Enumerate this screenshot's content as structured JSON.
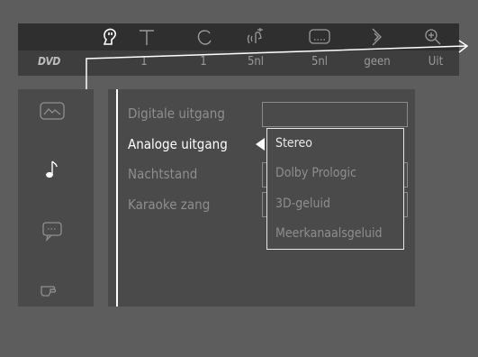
{
  "menu_bar": {
    "logo": "DVD",
    "icons": [
      "audio-settings-icon",
      "subtitle-icon",
      "chapter-icon",
      "audio-language-icon",
      "menu-icon",
      "angle-icon",
      "zoom-icon"
    ],
    "values": [
      "1",
      "1",
      "5nl",
      "5nl",
      "geen",
      "Uit"
    ]
  },
  "sidebar": {
    "icons": [
      "picture-icon",
      "music-note-icon",
      "speech-bubble-icon",
      "pointer-hand-icon"
    ]
  },
  "settings": {
    "labels": [
      "Digitale uitgang",
      "Analoge uitgang",
      "Nachtstand",
      "Karaoke zang"
    ],
    "active_index": 1
  },
  "dropdown": {
    "options": [
      "Stereo",
      "Dolby Prologic",
      "3D-geluid",
      "Meerkanaalsgeluid"
    ],
    "selected_index": 0
  }
}
